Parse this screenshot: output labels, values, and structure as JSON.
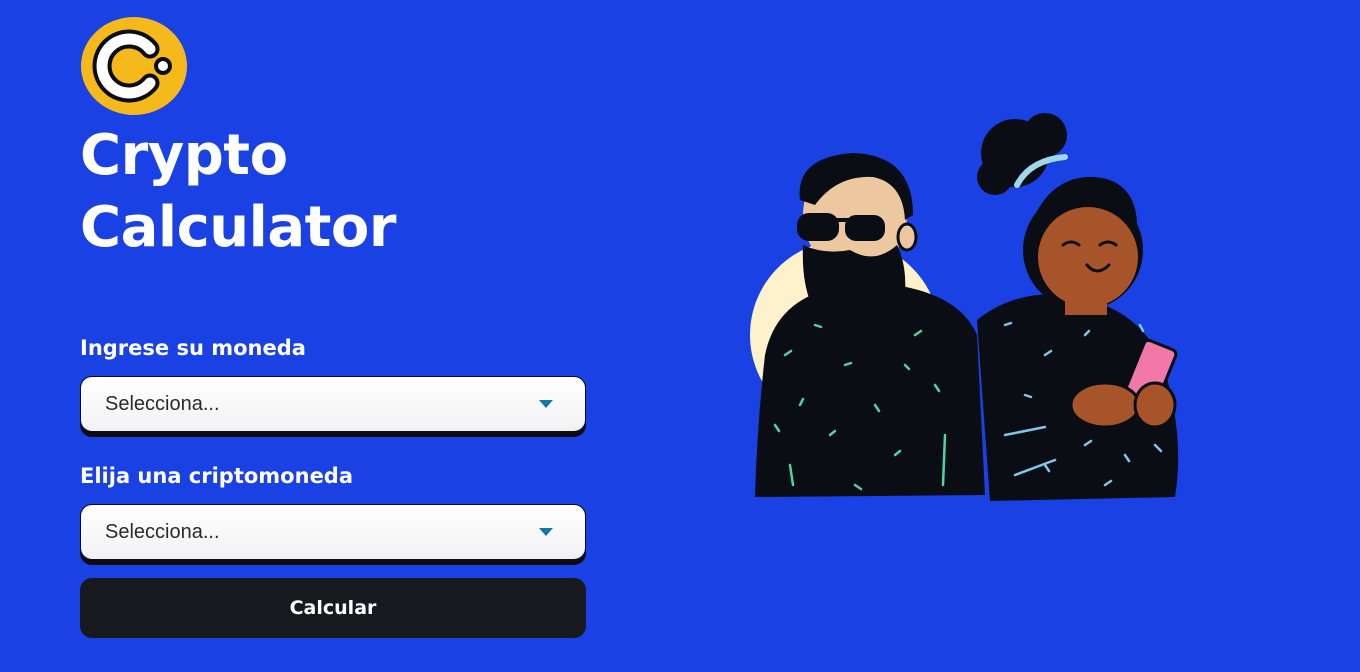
{
  "header": {
    "logo_icon": "crypto-coin-logo-icon",
    "title_line1": "Crypto",
    "title_line2": "Calculator"
  },
  "form": {
    "currency_label": "Ingrese su moneda",
    "currency_value": "Selecciona...",
    "crypto_label": "Elija una criptomoneda",
    "crypto_value": "Selecciona...",
    "submit_label": "Calcular"
  },
  "illustration": {
    "icon": "two-people-illustration"
  },
  "colors": {
    "background": "#1a41e4",
    "logo_yellow": "#f6b91c",
    "button": "#17191f",
    "caret": "#0c7aa5"
  }
}
